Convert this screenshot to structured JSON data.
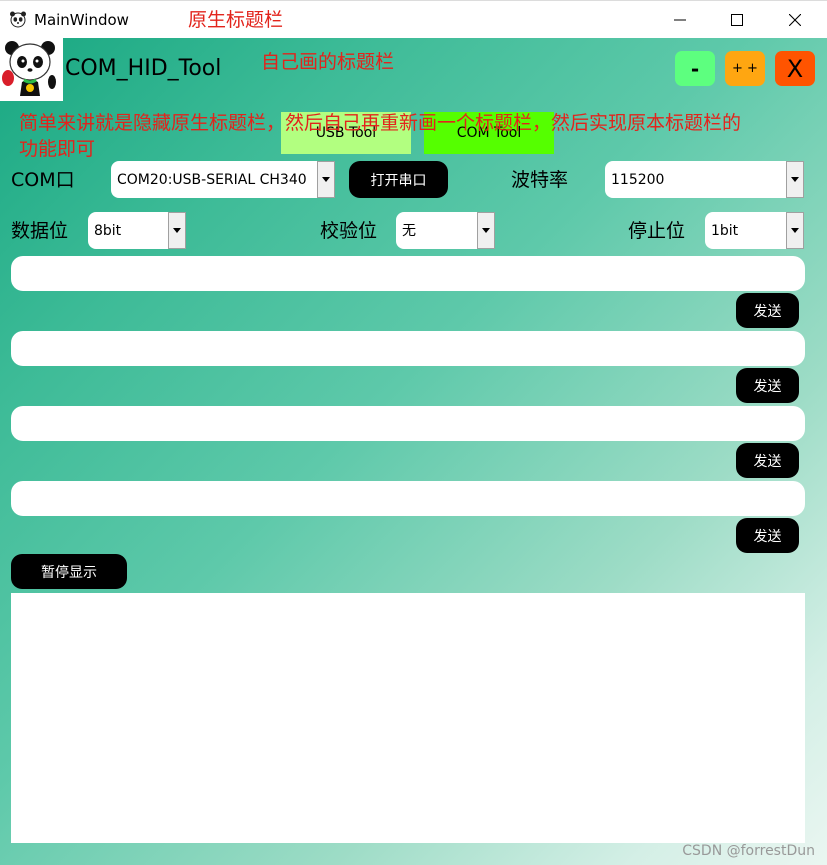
{
  "window": {
    "title": "MainWindow",
    "icon": "panda-icon",
    "native_bar_annotation": "原生标题栏",
    "controls": [
      "minimize-icon",
      "maximize-icon",
      "close-icon"
    ]
  },
  "custom_titlebar": {
    "title": "COM_HID_Tool",
    "annotation": "自己画的标题栏",
    "minimize_label": "-",
    "maximize_label": "+ +",
    "close_label": "X",
    "colors": {
      "minimize": "#5dff7f",
      "maximize": "#ffa611",
      "close": "#ff5400"
    }
  },
  "tool_tabs": {
    "usb_label": "USB Tool",
    "com_label": "COM Tool",
    "colors": {
      "usb": "#b2ff80",
      "com": "#55ff00"
    }
  },
  "summary_annotation": "简单来讲就是隐藏原生标题栏，然后自己再重新画一个标题栏，然后实现原本标题栏的功能即可",
  "serial": {
    "port_label": "COM口",
    "port_value": "COM20:USB-SERIAL CH340",
    "open_button": "打开串口",
    "baud_label": "波特率",
    "baud_value": "115200",
    "databits_label": "数据位",
    "databits_value": "8bit",
    "parity_label": "校验位",
    "parity_value": "无",
    "stopbits_label": "停止位",
    "stopbits_value": "1bit"
  },
  "send_rows": [
    {
      "value": "",
      "button": "发送"
    },
    {
      "value": "",
      "button": "发送"
    },
    {
      "value": "",
      "button": "发送"
    },
    {
      "value": "",
      "button": "发送"
    }
  ],
  "pause_button": "暂停显示",
  "output_text": "",
  "watermark": "CSDN @forrestDun",
  "theme": {
    "gradient_start": "#19a882",
    "gradient_end": "#eaf6f1",
    "annotation_color": "#e2241c"
  }
}
